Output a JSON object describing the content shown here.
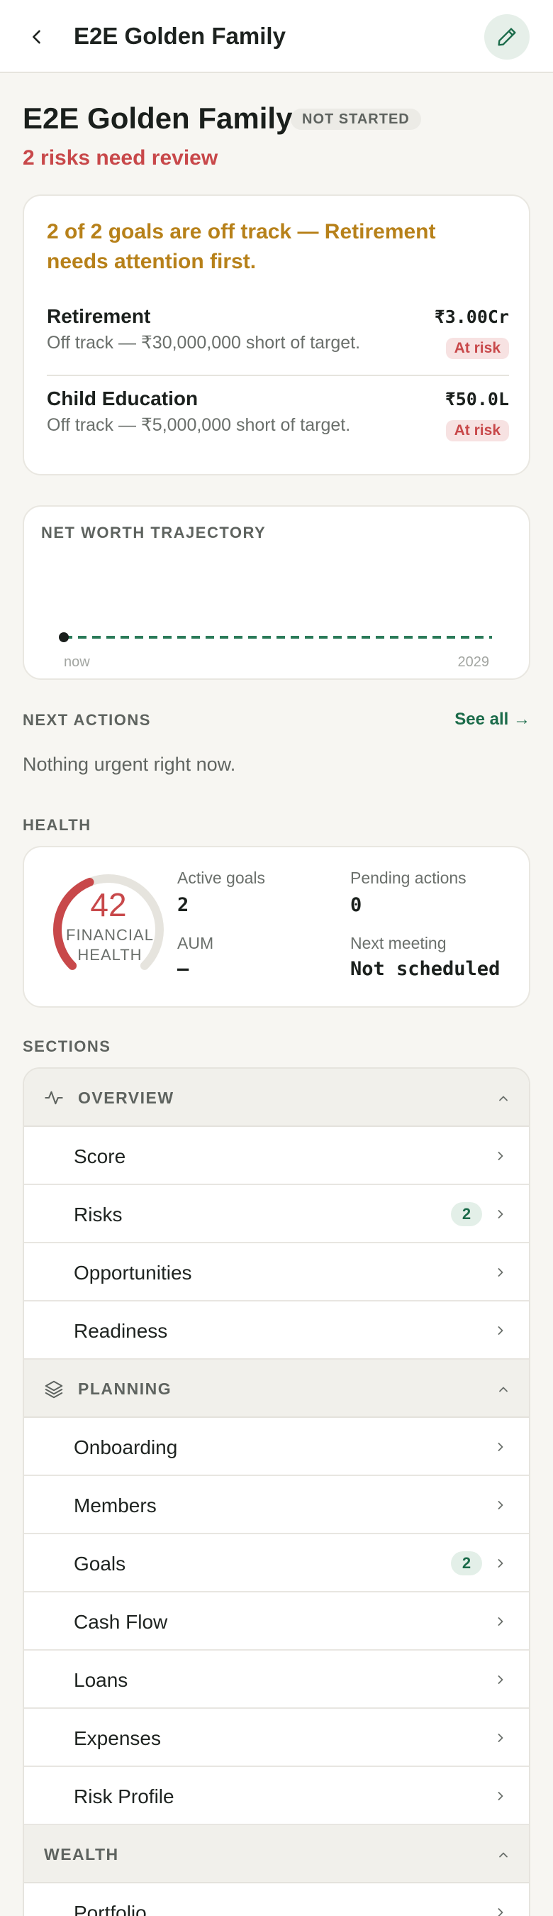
{
  "header": {
    "title": "E2E Golden Family"
  },
  "client": {
    "name": "E2E Golden Family",
    "status": "NOT STARTED",
    "risk_summary": "2 risks need review"
  },
  "goals_card": {
    "headline": "2 of 2 goals are off track — Retirement needs attention first.",
    "goals": [
      {
        "name": "Retirement",
        "detail": "Off track — ₹30,000,000 short of target.",
        "amount": "₹3.00Cr",
        "badge": "At risk"
      },
      {
        "name": "Child Education",
        "detail": "Off track — ₹5,000,000 short of target.",
        "amount": "₹50.0L",
        "badge": "At risk"
      }
    ]
  },
  "net_worth": {
    "title": "NET WORTH TRAJECTORY",
    "start_label": "now",
    "end_label": "2029"
  },
  "next_actions": {
    "title": "NEXT ACTIONS",
    "see_all": "See all →",
    "empty_text": "Nothing urgent right now."
  },
  "health": {
    "title": "HEALTH",
    "score": "42",
    "score_fraction": 0.42,
    "score_label": "FINANCIAL HEALTH",
    "metrics": [
      {
        "label": "Active goals",
        "value": "2"
      },
      {
        "label": "Pending actions",
        "value": "0"
      },
      {
        "label": "AUM",
        "value": "—"
      },
      {
        "label": "Next meeting",
        "value": "Not scheduled"
      }
    ]
  },
  "sections": {
    "title": "SECTIONS",
    "groups": [
      {
        "label": "OVERVIEW",
        "icon": "activity-icon",
        "items": [
          {
            "label": "Score"
          },
          {
            "label": "Risks",
            "badge": "2"
          },
          {
            "label": "Opportunities"
          },
          {
            "label": "Readiness"
          }
        ]
      },
      {
        "label": "PLANNING",
        "icon": "layers-icon",
        "items": [
          {
            "label": "Onboarding"
          },
          {
            "label": "Members"
          },
          {
            "label": "Goals",
            "badge": "2"
          },
          {
            "label": "Cash Flow"
          },
          {
            "label": "Loans"
          },
          {
            "label": "Expenses"
          },
          {
            "label": "Risk Profile"
          }
        ]
      },
      {
        "label": "WEALTH",
        "items": [
          {
            "label": "Portfolio"
          }
        ]
      }
    ]
  },
  "colors": {
    "accent": "#1b6b4a",
    "danger": "#c8484a",
    "warning": "#b7811a",
    "background": "#f7f6f2"
  }
}
